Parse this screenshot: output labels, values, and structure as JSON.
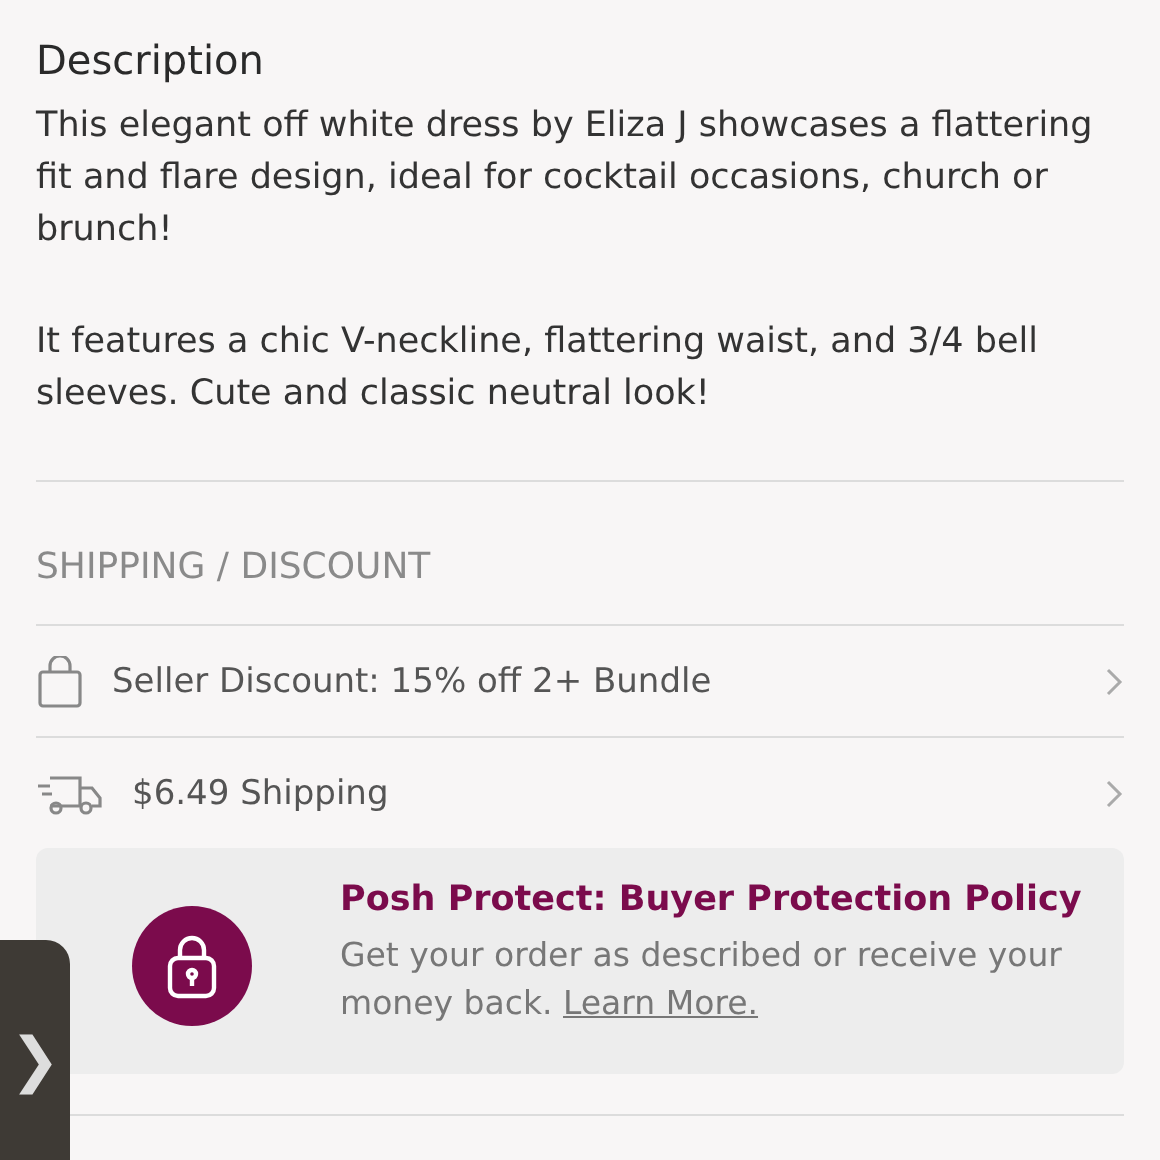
{
  "description": {
    "title": "Description",
    "paragraphs": [
      "This elegant off white dress by Eliza J showcases a flattering fit and flare design, ideal for cocktail occasions, church or brunch!",
      "It features a chic V-neckline, flattering waist, and 3/4 bell sleeves. Cute and classic neutral look!"
    ]
  },
  "shipping": {
    "heading": "SHIPPING / DISCOUNT",
    "rows": [
      {
        "kind": "bag",
        "label": "Seller Discount: 15% off 2+ Bundle"
      },
      {
        "kind": "truck",
        "label": "$6.49 Shipping"
      }
    ]
  },
  "protect": {
    "title": "Posh Protect: Buyer Protection Policy",
    "text": "Get your order as described or receive your money back.",
    "link": "Learn More."
  },
  "side_tab": {
    "glyph": "❯"
  }
}
